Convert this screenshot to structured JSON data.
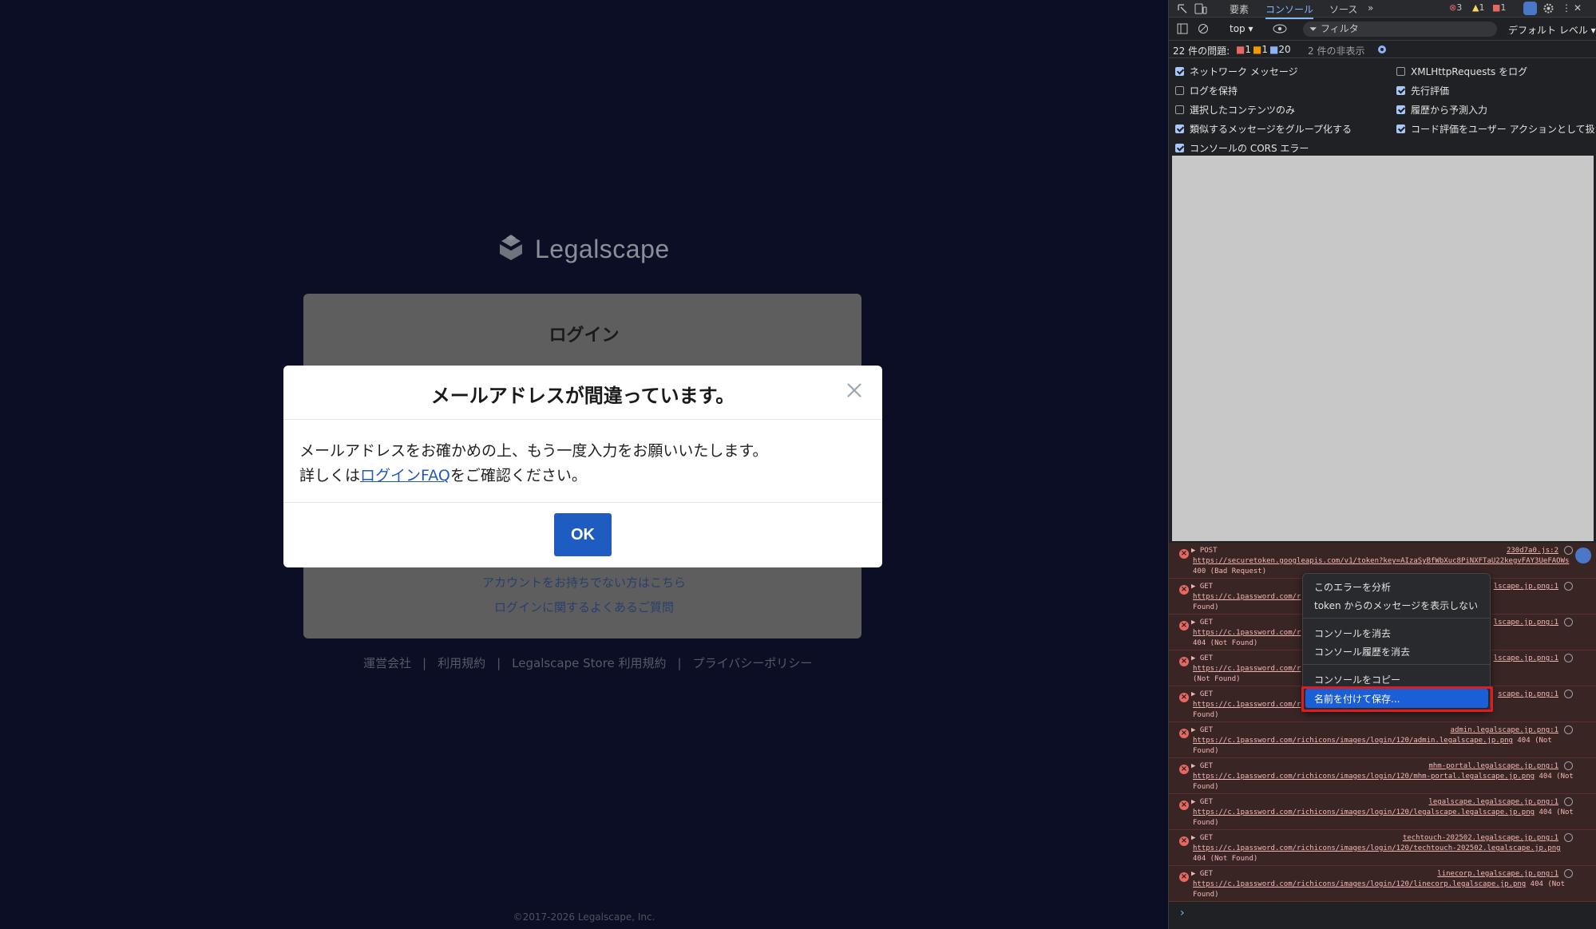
{
  "page": {
    "logo_text": "Legalscape",
    "login_title": "ログイン",
    "link_no_account": "アカウントをお持ちでない方はこちら",
    "link_faq": "ログインに関するよくあるご質問",
    "footer_links": [
      "運営会社",
      "利用規約",
      "Legalscape Store 利用規約",
      "プライバシーポリシー"
    ],
    "copyright": "©2017-2026 Legalscape, Inc."
  },
  "modal": {
    "title": "メールアドレスが間違っています。",
    "body_line1": "メールアドレスをお確かめの上、もう一度入力をお願いいたします。",
    "body_prefix": "詳しくは",
    "body_link": "ログインFAQ",
    "body_suffix": "をご確認ください。",
    "ok_label": "OK"
  },
  "devtools": {
    "tabs": [
      "要素",
      "コンソール",
      "ソース"
    ],
    "active_tab": "コンソール",
    "counts": {
      "errors": "3",
      "warnings": "1",
      "info": "1"
    },
    "context": "top",
    "filter_placeholder": "フィルタ",
    "level": "デフォルト レベル",
    "issues_label": "22 件の問題:",
    "issues_counts": [
      "1",
      "1",
      "20"
    ],
    "hidden_label": "2 件の非表示",
    "settings": [
      {
        "label": "ネットワーク メッセージ",
        "checked": true
      },
      {
        "label": "XMLHttpRequests をログ",
        "checked": false
      },
      {
        "label": "ログを保持",
        "checked": false
      },
      {
        "label": "先行評価",
        "checked": true
      },
      {
        "label": "選択したコンテンツのみ",
        "checked": false
      },
      {
        "label": "履歴から予測入力",
        "checked": true
      },
      {
        "label": "類似するメッセージをグループ化する",
        "checked": true
      },
      {
        "label": "コード評価をユーザー アクションとして扱う",
        "checked": true
      },
      {
        "label": "コンソールの CORS エラー",
        "checked": true
      }
    ],
    "logs": [
      {
        "method": "▶ POST",
        "src": "230d7a0.js:2",
        "url": "https://securetoken.googleapis.com/v1/token?key=AIzaSyBfWbXuc8PiNXFTaU22kegvFAY3UeFAOWs",
        "status": "400 (Bad Request)"
      },
      {
        "method": "▶ GET",
        "src": "lscape.jp.png:1",
        "url": "https://c.1password.com/r",
        "tail": "scape.jp.png 404 (Not",
        "status": "Found)"
      },
      {
        "method": "▶ GET",
        "src": "lscape.jp.png:1",
        "url": "https://c.1password.com/r",
        "tail": "28.legalscape.jp.png",
        "status": "404 (Not Found)"
      },
      {
        "method": "▶ GET",
        "src": "lscape.jp.png:1",
        "url": "https://c.1password.com/r",
        "tail": "lscape.jp.png 404",
        "status": "(Not Found)"
      },
      {
        "method": "▶ GET",
        "src": "scape.jp.png:1",
        "url": "https://c.1password.com/r",
        "tail": ".png 404 (Not",
        "status": "Found)"
      },
      {
        "method": "▶ GET",
        "src": "admin.legalscape.jp.png:1",
        "url": "https://c.1password.com/richicons/images/login/120/admin.legalscape.jp.png",
        "tail": "404 (Not",
        "status": "Found)"
      },
      {
        "method": "▶ GET",
        "src": "mhm-portal.legalscape.jp.png:1",
        "url": "https://c.1password.com/richicons/images/login/120/mhm-portal.legalscape.jp.png",
        "tail": "404 (Not",
        "status": "Found)"
      },
      {
        "method": "▶ GET",
        "src": "legalscape.legalscape.jp.png:1",
        "url": "https://c.1password.com/richicons/images/login/120/legalscape.legalscape.jp.png",
        "tail": "404 (Not",
        "status": "Found)"
      },
      {
        "method": "▶ GET",
        "src": "techtouch-202502.legalscape.jp.png:1",
        "url": "https://c.1password.com/richicons/images/login/120/techtouch-202502.legalscape.jp.png",
        "tail": "",
        "status": "404 (Not Found)"
      },
      {
        "method": "▶ GET",
        "src": "linecorp.legalscape.jp.png:1",
        "url": "https://c.1password.com/richicons/images/login/120/linecorp.legalscape.jp.png",
        "tail": "404 (Not",
        "status": "Found)"
      }
    ],
    "context_menu": [
      "このエラーを分析",
      "token からのメッセージを表示しない",
      "コンソールを消去",
      "コンソール履歴を消去",
      "コンソールをコピー",
      "名前を付けて保存..."
    ],
    "prompt": "›"
  }
}
